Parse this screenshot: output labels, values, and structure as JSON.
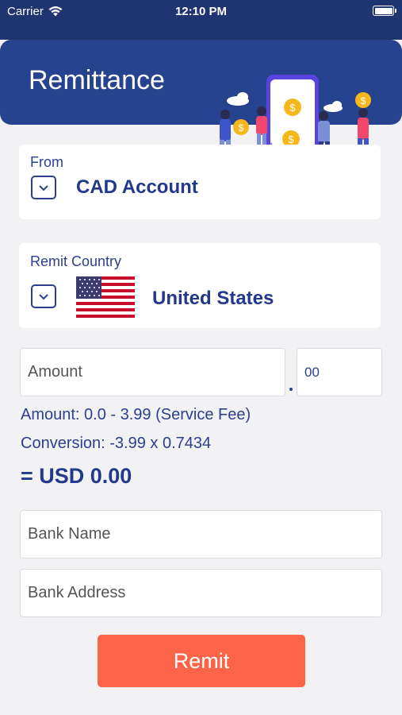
{
  "status_bar": {
    "carrier": "Carrier",
    "time": "12:10 PM"
  },
  "header": {
    "title": "Remittance"
  },
  "from_card": {
    "label": "From",
    "value": "CAD Account"
  },
  "country_card": {
    "label": "Remit Country",
    "value": "United States",
    "flag": "us-flag"
  },
  "amount": {
    "placeholder": "Amount",
    "cents_value": "00"
  },
  "info": {
    "amount_line": "Amount: 0.0 - 3.99 (Service Fee)",
    "conversion_line": "Conversion: -3.99 x 0.7434",
    "total_line": "= USD 0.00"
  },
  "bank": {
    "name_placeholder": "Bank Name",
    "address_placeholder": "Bank Address"
  },
  "actions": {
    "remit_label": "Remit"
  },
  "colors": {
    "primary": "#25438e",
    "accent": "#fb6446",
    "text": "#22388a"
  }
}
